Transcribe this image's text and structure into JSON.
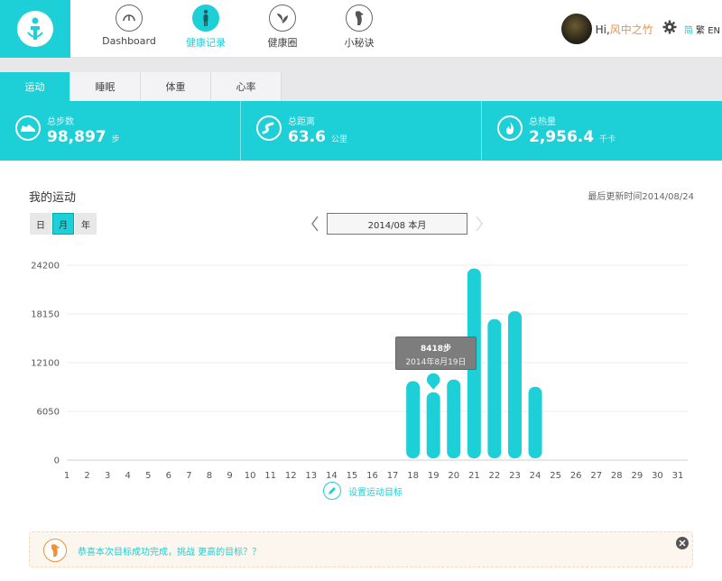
{
  "nav": {
    "items": [
      {
        "label": "Dashboard",
        "icon": "gauge-icon",
        "active": false
      },
      {
        "label": "健康记录",
        "icon": "person-icon",
        "active": true
      },
      {
        "label": "健康圈",
        "icon": "leaf-icon",
        "active": false
      },
      {
        "label": "小秘诀",
        "icon": "penguin-icon",
        "active": false
      }
    ],
    "greeting": "Hi,",
    "username": "风中之竹",
    "lang_simplified": "简",
    "lang_traditional": "繁",
    "lang_english": "EN"
  },
  "tabs": [
    {
      "label": "运动",
      "active": true
    },
    {
      "label": "睡眠",
      "active": false
    },
    {
      "label": "体重",
      "active": false
    },
    {
      "label": "心率",
      "active": false
    }
  ],
  "stats": [
    {
      "label": "总步数",
      "value": "98,897",
      "unit": "步",
      "icon": "shoe-icon"
    },
    {
      "label": "总距离",
      "value": "63.6",
      "unit": "公里",
      "icon": "road-icon"
    },
    {
      "label": "总热量",
      "value": "2,956.4",
      "unit": "千卡",
      "icon": "flame-icon"
    }
  ],
  "section": {
    "title": "我的运动",
    "last_update": "最后更新时间2014/08/24",
    "periods": [
      {
        "label": "日",
        "active": false
      },
      {
        "label": "月",
        "active": true
      },
      {
        "label": "年",
        "active": false
      }
    ],
    "current_month": "2014/08  本月"
  },
  "tooltip": {
    "value": "8418步",
    "date": "2014年8月19日"
  },
  "goal_link": "设置运动目标",
  "notice": "恭喜本次目标成功完成，挑战 更高的目标？？",
  "colors": {
    "accent": "#1dcfd6",
    "orange": "#f0913c"
  },
  "chart_data": {
    "type": "bar",
    "categories": [
      "1",
      "2",
      "3",
      "4",
      "5",
      "6",
      "7",
      "8",
      "9",
      "10",
      "11",
      "12",
      "13",
      "14",
      "15",
      "16",
      "17",
      "18",
      "19",
      "20",
      "21",
      "22",
      "23",
      "24",
      "25",
      "26",
      "27",
      "28",
      "29",
      "30",
      "31"
    ],
    "values": [
      0,
      0,
      0,
      0,
      0,
      0,
      0,
      0,
      0,
      0,
      0,
      0,
      0,
      0,
      0,
      0,
      0,
      9800,
      8418,
      10000,
      23800,
      17500,
      18500,
      9100,
      0,
      0,
      0,
      0,
      0,
      0,
      0
    ],
    "yticks": [
      0,
      6050,
      12100,
      18150,
      24200
    ],
    "ylim": [
      0,
      24200
    ],
    "highlight_index": 18
  }
}
